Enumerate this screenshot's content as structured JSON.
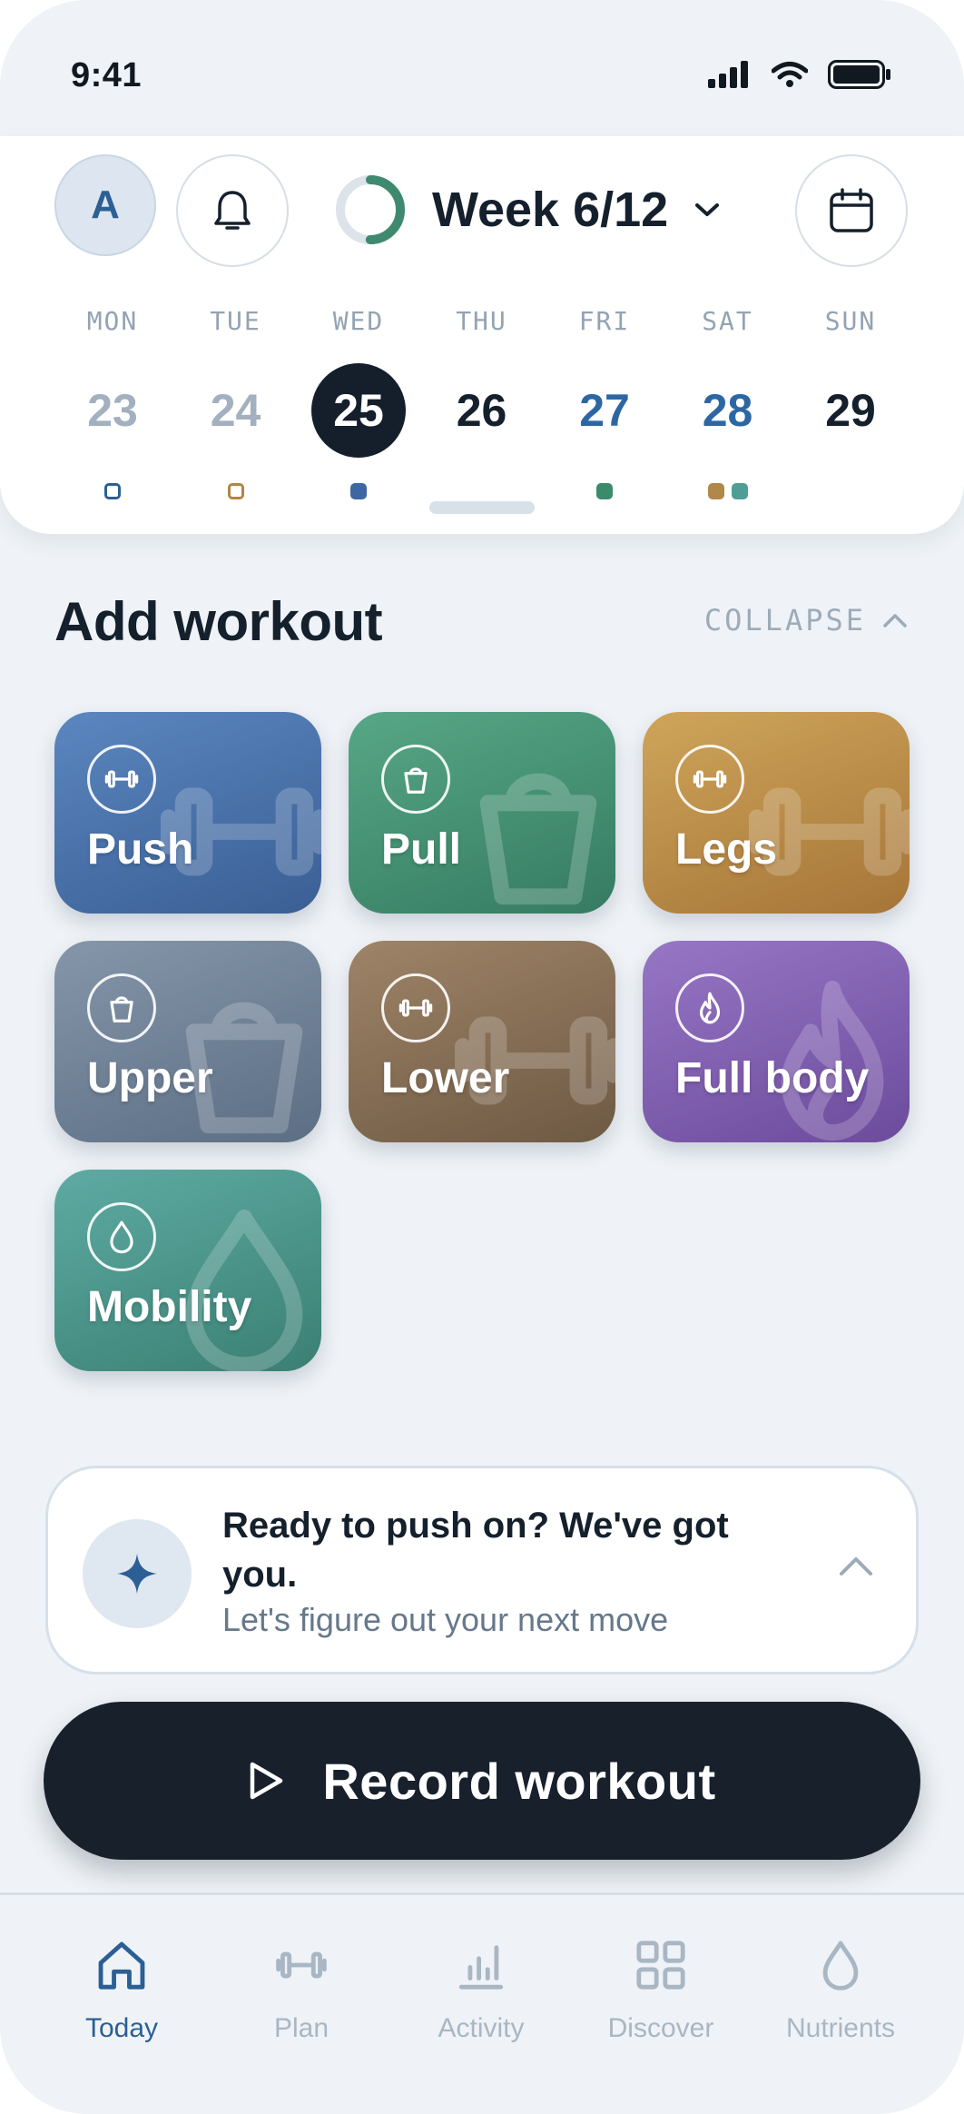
{
  "status_bar": {
    "time": "9:41"
  },
  "header": {
    "avatar_initial": "A",
    "week_label": "Week 6/12",
    "week_progress": 0.5
  },
  "days": [
    {
      "name": "MON",
      "num": "23",
      "state": "past",
      "dots": [
        {
          "color": "#2b5f95",
          "hollow": true
        }
      ]
    },
    {
      "name": "TUE",
      "num": "24",
      "state": "past",
      "dots": [
        {
          "color": "#b28544",
          "hollow": true
        }
      ]
    },
    {
      "name": "WED",
      "num": "25",
      "state": "today",
      "dots": [
        {
          "color": "#3d66a3",
          "hollow": false
        }
      ]
    },
    {
      "name": "THU",
      "num": "26",
      "state": "future",
      "dots": []
    },
    {
      "name": "FRI",
      "num": "27",
      "state": "planned",
      "dots": [
        {
          "color": "#3b8a6c",
          "hollow": false
        }
      ]
    },
    {
      "name": "SAT",
      "num": "28",
      "state": "planned",
      "dots": [
        {
          "color": "#b2884a",
          "hollow": false
        },
        {
          "color": "#4f9e96",
          "hollow": false
        }
      ]
    },
    {
      "name": "SUN",
      "num": "29",
      "state": "future",
      "dots": []
    }
  ],
  "add_workout": {
    "title": "Add workout",
    "collapse_label": "COLLAPSE",
    "tiles": [
      {
        "label": "Push",
        "icon": "dumbbell-icon",
        "color_top": "#5b86bf",
        "color_bottom": "#3a5f95"
      },
      {
        "label": "Pull",
        "icon": "kettlebell-icon",
        "color_top": "#57a786",
        "color_bottom": "#357b62"
      },
      {
        "label": "Legs",
        "icon": "dumbbell-icon",
        "color_top": "#cfa55a",
        "color_bottom": "#a57538"
      },
      {
        "label": "Upper",
        "icon": "kettlebell-icon",
        "color_top": "#8596aa",
        "color_bottom": "#5c6e84"
      },
      {
        "label": "Lower",
        "icon": "dumbbell-icon",
        "color_top": "#9e8468",
        "color_bottom": "#6e5943"
      },
      {
        "label": "Full body",
        "icon": "flame-icon",
        "color_top": "#9676c5",
        "color_bottom": "#6c4b9c"
      },
      {
        "label": "Mobility",
        "icon": "droplet-icon",
        "color_top": "#5eaba3",
        "color_bottom": "#3a7f73"
      }
    ]
  },
  "suggestion": {
    "title": "Ready to push on? We've got you.",
    "subtitle": "Let's figure out your next move"
  },
  "record": {
    "label": "Record workout"
  },
  "tabs": [
    {
      "label": "Today",
      "icon": "home-icon",
      "active": true
    },
    {
      "label": "Plan",
      "icon": "dumbbell-icon",
      "active": false
    },
    {
      "label": "Activity",
      "icon": "bar-chart-icon",
      "active": false
    },
    {
      "label": "Discover",
      "icon": "grid-icon",
      "active": false
    },
    {
      "label": "Nutrients",
      "icon": "droplet-icon",
      "active": false
    }
  ],
  "colors": {
    "accent": "#2b5f95",
    "dark": "#17202b",
    "muted": "#a9b6c3",
    "ring_track": "#dde3ea",
    "ring_fill": "#3f8a6e"
  }
}
